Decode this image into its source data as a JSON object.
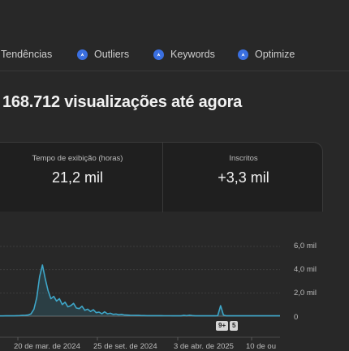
{
  "nav": {
    "items": [
      {
        "label": "Tendências",
        "icon": null
      },
      {
        "label": "Outliers",
        "icon": "compass-icon"
      },
      {
        "label": "Keywords",
        "icon": "compass-icon"
      },
      {
        "label": "Optimize",
        "icon": "compass-icon"
      }
    ]
  },
  "headline": "168.712 visualizações até agora",
  "stats": [
    {
      "label": "Tempo de exibição (horas)",
      "value": "21,2 mil"
    },
    {
      "label": "Inscritos",
      "value": "+3,3 mil"
    }
  ],
  "chart_data": {
    "type": "line",
    "title": "",
    "ylabel": "",
    "xlabel": "",
    "ylim": [
      0,
      6000
    ],
    "y_tick_labels": [
      "6,0 mil",
      "4,0 mil",
      "2,0 mil",
      "0"
    ],
    "x_tick_labels": [
      "20 de mar. de 2024",
      "25 de set. de 2024",
      "3 de abr. de 2025",
      "10 de ou"
    ],
    "grid": true,
    "line_color": "#3ea6c8",
    "series": [
      {
        "values": [
          20,
          20,
          25,
          25,
          30,
          30,
          40,
          50,
          60,
          80,
          100,
          200,
          600,
          1600,
          3400,
          4400,
          3200,
          2200,
          1500,
          1700,
          1300,
          1500,
          1000,
          1200,
          800,
          900,
          1100,
          700,
          650,
          850,
          500,
          600,
          400,
          550,
          300,
          350,
          200,
          380,
          200,
          250,
          150,
          180,
          120,
          150,
          100,
          90,
          80,
          70,
          60,
          60,
          50,
          50,
          45,
          45,
          40,
          40,
          40,
          40,
          35,
          35,
          35,
          30,
          30,
          30,
          30,
          60,
          40,
          80,
          50,
          30,
          30,
          30,
          30,
          30,
          30,
          30,
          30,
          40,
          900,
          100,
          30,
          30,
          30,
          30,
          30,
          30,
          30,
          30,
          30,
          30,
          30,
          30,
          30,
          30,
          30,
          30,
          30,
          30,
          30,
          30
        ]
      }
    ]
  },
  "markers": [
    "9+",
    "5"
  ]
}
